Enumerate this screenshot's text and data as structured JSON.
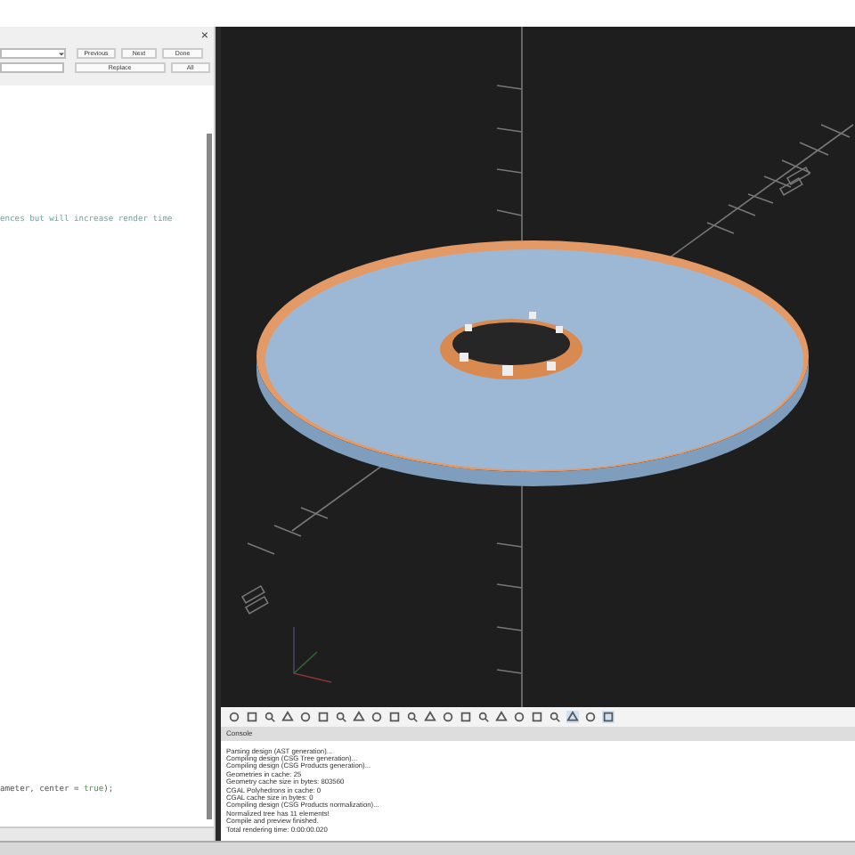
{
  "find_bar": {
    "buttons": [
      "Previous",
      "Next",
      "Done"
    ],
    "replace_buttons": [
      "Replace",
      "All"
    ],
    "close": "×"
  },
  "editor": {
    "lines": [
      {
        "segments": [
          {
            "text": "ences but will increase render time",
            "kind": "comment"
          }
        ]
      },
      {
        "segments": [
          {
            "text": "ameter, center = ",
            "kind": "plain"
          },
          {
            "text": "true",
            "kind": "keyword"
          },
          {
            "text": ");",
            "kind": "plain"
          }
        ]
      }
    ]
  },
  "console": {
    "title": "Console",
    "lines": [
      "Parsing design (AST generation)...",
      "Compiling design (CSG Tree generation)...",
      "Compiling design (CSG Products generation)...",
      "Geometries in cache: 25",
      "Geometry cache size in bytes: 803560",
      "CGAL Polyhedrons in cache: 0",
      "CGAL cache size in bytes: 0",
      "Compiling design (CSG Products normalization)...",
      "Normalized tree has 11 elements!",
      "Compile and preview finished.",
      "Total rendering time: 0:00:00.020"
    ]
  }
}
